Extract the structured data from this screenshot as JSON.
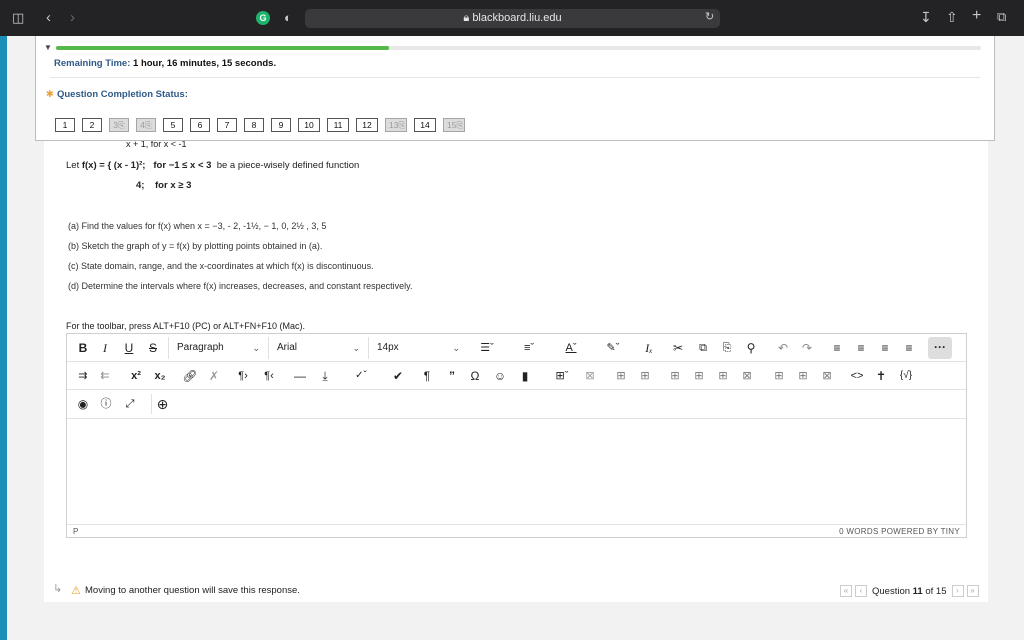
{
  "browser": {
    "url": "blackboard.liu.edu",
    "grammarly_letter": "G"
  },
  "status": {
    "progress": 0.36,
    "remaining_label": "Remaining Time:",
    "remaining_value": "1 hour, 16 minutes, 15 seconds.",
    "completion_label": "Question Completion Status:",
    "questions": [
      {
        "n": "1",
        "answered": false
      },
      {
        "n": "2",
        "answered": false
      },
      {
        "n": "3",
        "answered": true
      },
      {
        "n": "4",
        "answered": true
      },
      {
        "n": "5",
        "answered": false
      },
      {
        "n": "6",
        "answered": false
      },
      {
        "n": "7",
        "answered": false
      },
      {
        "n": "8",
        "answered": false
      },
      {
        "n": "9",
        "answered": false
      },
      {
        "n": "10",
        "answered": false
      },
      {
        "n": "11",
        "answered": false
      },
      {
        "n": "12",
        "answered": false
      },
      {
        "n": "13",
        "answered": true
      },
      {
        "n": "14",
        "answered": false
      },
      {
        "n": "15",
        "answered": true
      }
    ]
  },
  "question": {
    "cut_line": "x + 1,  for  x < -1",
    "def_prefix": "Let ",
    "def_func": "f(x) = { (x - 1)²;",
    "def_cond": "for −1 ≤ x < 3",
    "def_suffix": "be a piece-wisely defined function",
    "def_line2_val": "4;",
    "def_line2_cond": "for  x ≥ 3",
    "parts": [
      "(a) Find the values for f(x) when x = −3, - 2, -1½,  − 1, 0,  2½ , 3, 5",
      "(b) Sketch the graph of y = f(x) by plotting points obtained in (a).",
      "(c) State domain, range, and the x-coordinates at which f(x) is discontinuous.",
      "(d) Determine the intervals where f(x) increases, decreases, and constant respectively."
    ],
    "toolbar_hint": "For the toolbar, press ALT+F10 (PC) or ALT+FN+F10 (Mac)."
  },
  "editor": {
    "format_select": "Paragraph",
    "font_select": "Arial",
    "size_select": "14px",
    "status_path": "P",
    "status_right": "0 WORDS  POWERED BY TINY"
  },
  "footer": {
    "warning": "Moving to another question will save this response.",
    "question_label_pre": "Question ",
    "question_current": "11",
    "question_label_post": " of 15"
  }
}
